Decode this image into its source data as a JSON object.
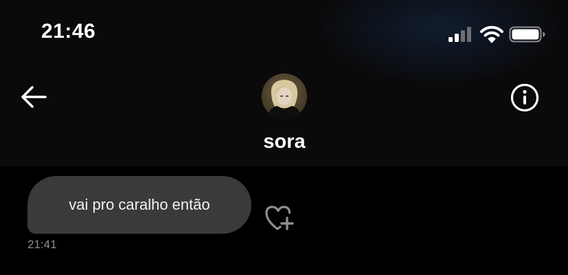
{
  "status_bar": {
    "time": "21:46"
  },
  "header": {
    "contact_name": "sora",
    "back_icon": "arrow-left-icon",
    "info_icon": "info-circle-icon",
    "avatar_icon": "profile-photo"
  },
  "messages": [
    {
      "text": "vai pro caralho então",
      "time": "21:41",
      "direction": "incoming"
    }
  ],
  "colors": {
    "background": "#000000",
    "header_background": "#0a0a0b",
    "bubble_incoming": "#3a3a3c",
    "timestamp": "#8e8e93",
    "icon": "#ffffff"
  }
}
